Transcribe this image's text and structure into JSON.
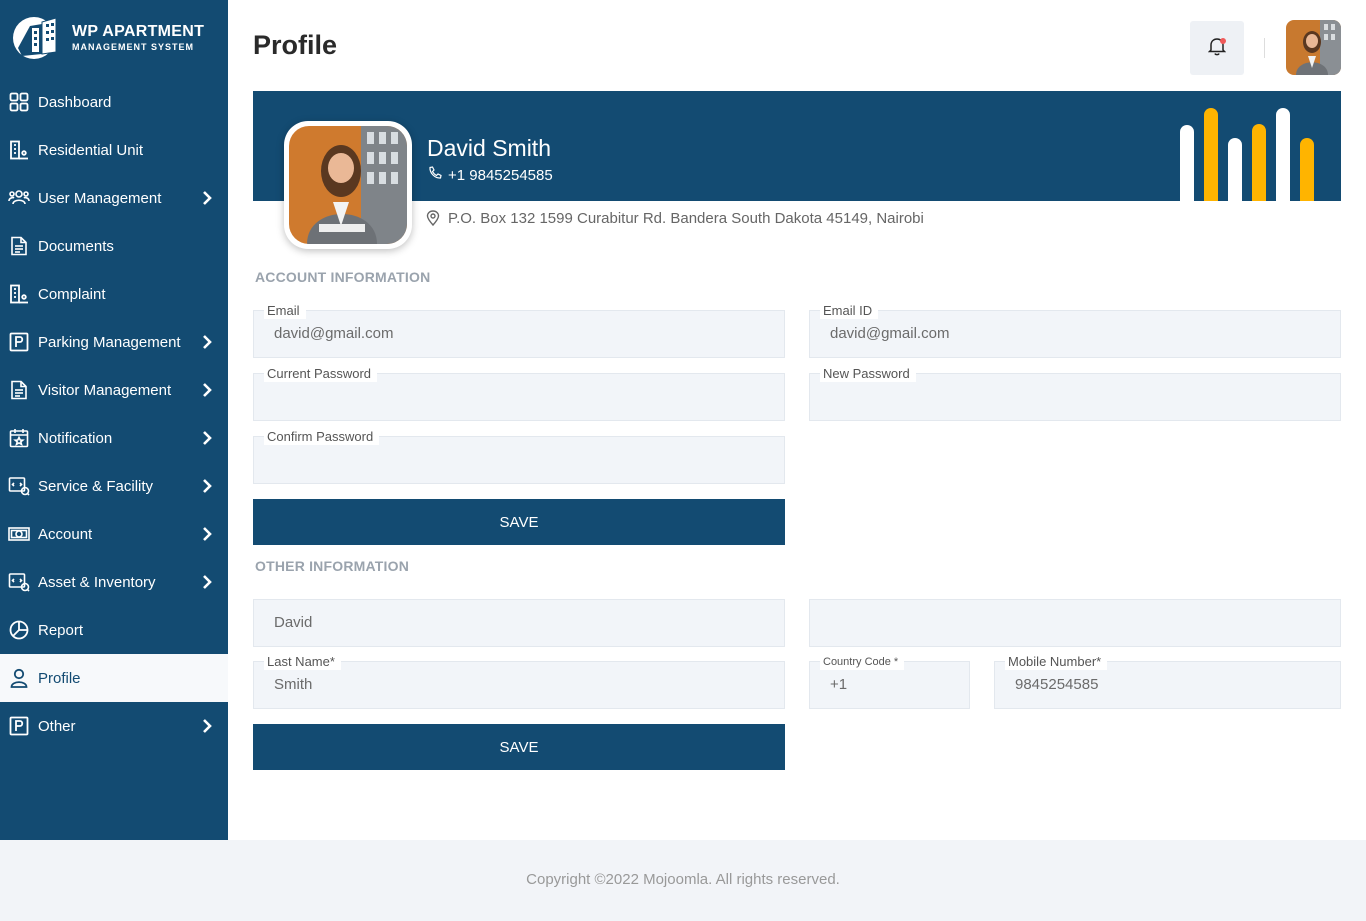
{
  "brand": {
    "title": "WP APARTMENT",
    "subtitle": "MANAGEMENT SYSTEM"
  },
  "nav": [
    {
      "label": "Dashboard",
      "icon": "dashboard-icon",
      "chevron": false
    },
    {
      "label": "Residential Unit",
      "icon": "building-icon",
      "chevron": false
    },
    {
      "label": "User Management",
      "icon": "users-icon",
      "chevron": true
    },
    {
      "label": "Documents",
      "icon": "document-icon",
      "chevron": false
    },
    {
      "label": "Complaint",
      "icon": "complaint-icon",
      "chevron": false
    },
    {
      "label": "Parking Management",
      "icon": "parking-icon",
      "chevron": true
    },
    {
      "label": "Visitor Management",
      "icon": "visitor-icon",
      "chevron": true
    },
    {
      "label": "Notification",
      "icon": "calendar-star-icon",
      "chevron": true
    },
    {
      "label": "Service & Facility",
      "icon": "service-icon",
      "chevron": true
    },
    {
      "label": "Account",
      "icon": "money-icon",
      "chevron": true
    },
    {
      "label": "Asset & Inventory",
      "icon": "asset-icon",
      "chevron": true
    },
    {
      "label": "Report",
      "icon": "pie-chart-icon",
      "chevron": false
    },
    {
      "label": "Profile",
      "icon": "user-icon",
      "chevron": false,
      "active": true
    },
    {
      "label": "Other",
      "icon": "parking-icon",
      "chevron": true
    }
  ],
  "header": {
    "title": "Profile"
  },
  "profile": {
    "name": "David Smith",
    "phone": "+1  9845254585",
    "address": "P.O. Box 132 1599 Curabitur Rd. Bandera South Dakota 45149, Nairobi"
  },
  "account": {
    "section_title": "ACCOUNT INFORMATION",
    "email_label": "Email",
    "email_value": "david@gmail.com",
    "email_id_label": "Email ID",
    "email_id_value": "david@gmail.com",
    "current_password_label": "Current Password",
    "new_password_label": "New Password",
    "confirm_password_label": "Confirm Password",
    "save_label": "SAVE"
  },
  "other": {
    "section_title": "OTHER INFORMATION",
    "first_name_value": "David",
    "last_name_label": "Last Name*",
    "last_name_value": "Smith",
    "country_code_label": "Country Code *",
    "country_code_value": "+1",
    "mobile_label": "Mobile Number*",
    "mobile_value": "9845254585",
    "save_label": "SAVE"
  },
  "footer": {
    "copyright": "Copyright ©2022 Mojoomla. All rights reserved."
  },
  "colors": {
    "primary": "#134b72",
    "accent": "#ffb400",
    "notification_dot": "#f05a5a"
  }
}
